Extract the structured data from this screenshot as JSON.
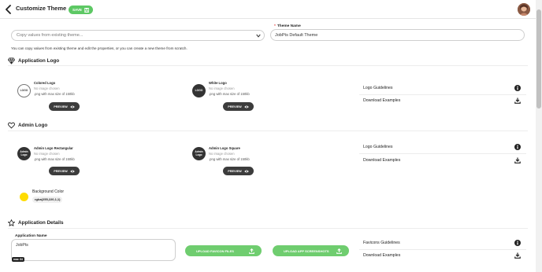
{
  "header": {
    "title": "Customize Theme",
    "save_label": "SAVE"
  },
  "copy_select": {
    "placeholder": "Copy values from existing theme...",
    "help_text": "You can copy values from existing theme and edit the properties, or you can create a new theme from scratch."
  },
  "theme_name": {
    "required_mark": "*",
    "label": "Theme Name",
    "value": "JobPts Default Theme"
  },
  "application_logo": {
    "heading": "Application Logo",
    "colored": {
      "circle_text": "LOGO",
      "title": "Colored Logo",
      "status": "No image chosen",
      "size_hint": ".png with max size of 150kb",
      "preview_label": "PREVIEW"
    },
    "white": {
      "circle_text": "LOGO",
      "title": "White Logo",
      "status": "No image chosen",
      "size_hint": ".png with max size of 150kb",
      "preview_label": "PREVIEW"
    },
    "guidelines_label": "Logo Guidelines",
    "examples_label": "Download Examples"
  },
  "admin_logo": {
    "heading": "Admin Logo",
    "rectangular": {
      "circle_text": "Admin Logo",
      "title": "Admin Logo Rectangular",
      "status": "No image chosen",
      "size_hint": ".png with max size of 150kb",
      "preview_label": "PREVIEW"
    },
    "square": {
      "circle_text": "Admin Logo",
      "title": "Admin Logo Square",
      "status": "No image chosen",
      "size_hint": ".png with max size of 150kb",
      "preview_label": "PREVIEW"
    },
    "guidelines_label": "Logo Guidelines",
    "examples_label": "Download Examples",
    "background_color_label": "Background Color",
    "background_color_value": "rgba(255,220,1,1)",
    "background_color_hex": "#ffdc01"
  },
  "application_details": {
    "heading": "Application Details",
    "app_name_label": "Application Name",
    "app_name_value": "JobPts",
    "max_badge": "max: 84",
    "upload_favicon_label": "UPLOAD FAVICON FILES",
    "upload_screenshots_label": "UPLOAD APP SCREENSHOTS",
    "favicons_guidelines_label": "Favicons Guidelines",
    "examples_label": "Download Examples"
  },
  "colors": {
    "accent_green": "#5dc864",
    "dark_button": "#3c3c3c",
    "required_red": "#e53935"
  },
  "icons": [
    "back-arrow-icon",
    "save-icon",
    "chevron-down-icon",
    "diamond-icon",
    "heart-icon",
    "star-icon",
    "eye-icon",
    "info-icon",
    "download-icon",
    "upload-icon"
  ]
}
